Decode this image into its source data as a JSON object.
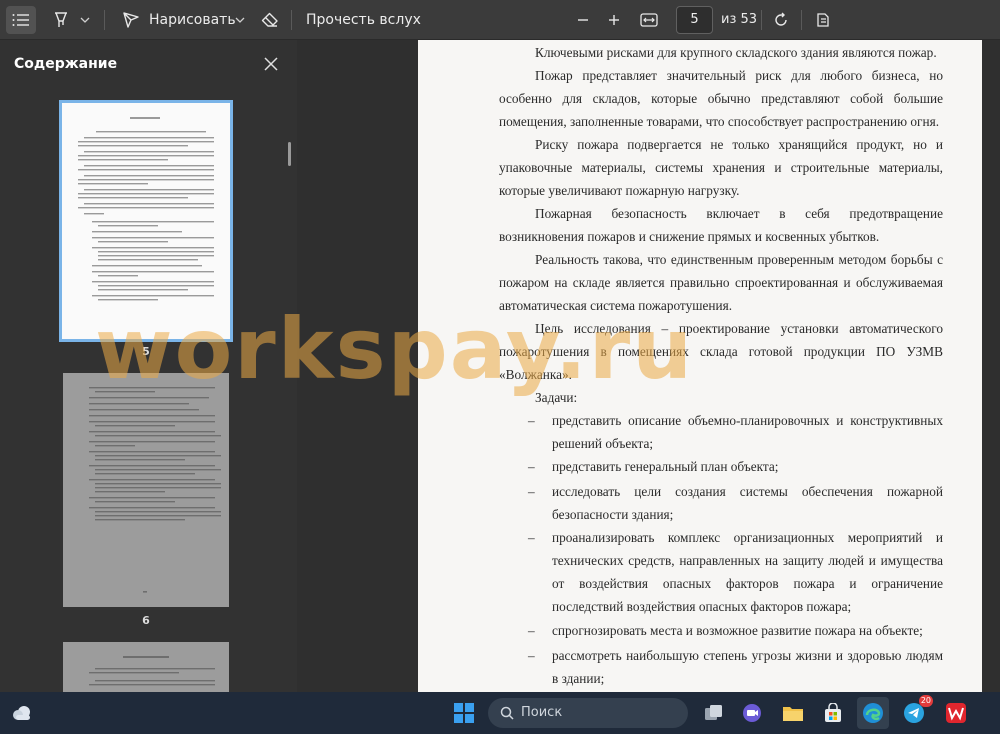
{
  "toolbar": {
    "draw_label": "Нарисовать",
    "read_aloud_label": "Прочесть вслух",
    "current_page": "5",
    "total_pages_label": "из 53"
  },
  "sidebar": {
    "title": "Содержание",
    "thumbnails": [
      {
        "label": "5"
      },
      {
        "label": "6"
      }
    ]
  },
  "document": {
    "paragraphs": [
      "Ключевыми рисками для крупного складского здания являются пожар.",
      "Пожар представляет значительный риск для любого бизнеса, но особенно для складов, которые обычно представляют собой большие помещения, заполненные товарами, что способствует распространению огня.",
      "Риску пожара подвергается не только хранящийся продукт, но и упаковочные материалы, системы хранения и строительные материалы, которые увеличивают пожарную нагрузку.",
      "Пожарная безопасность включает в себя предотвращение возникновения пожаров и снижение прямых и косвенных убытков.",
      "Реальность такова, что единственным проверенным методом борьбы с пожаром на складе является правильно спроектированная и обслуживаемая автоматическая система пожаротушения.",
      "Цель исследования – проектирование установки автоматического пожаротушения в помещениях склада готовой продукции ПО УЗМВ «Волжанка»."
    ],
    "tasks_label": "Задачи:",
    "tasks": [
      "представить описание объемно-планировочных и конструктивных решений объекта;",
      "представить генеральный план объекта;",
      "исследовать цели создания системы обеспечения пожарной безопасности здания;",
      "проанализировать комплекс организационных мероприятий и технических средств, направленных на защиту людей и имущества от воздействия опасных факторов пожара и ограничение последствий воздействия опасных факторов пожара;",
      "спрогнозировать места и возможное развитие пожара на объекте;",
      "рассмотреть наибольшую степень угрозы жизни и здоровью людям в здании;"
    ],
    "dash": "–"
  },
  "watermark": "workspay.ru",
  "taskbar": {
    "search_label": "Поиск",
    "telegram_badge": "20"
  },
  "colors": {
    "toolbar_bg": "#3b3b3b",
    "sidebar_bg": "#323232",
    "page_bg": "#f7f6f4",
    "taskbar_bg": "#1f2a3a",
    "selected_thumb_border": "#7ab4e8",
    "watermark": "#ebaa46"
  }
}
